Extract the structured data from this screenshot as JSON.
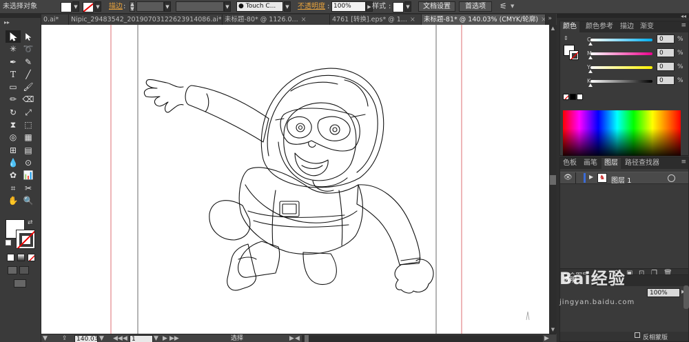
{
  "control_bar": {
    "selection_status": "未选择对象",
    "stroke_label": "描边",
    "brush_name": "Touch C...",
    "opacity_label": "不透明度",
    "opacity_value": "100%",
    "style_label": "样式",
    "doc_setup_button": "文档设置",
    "preferences_button": "首选项"
  },
  "doc_tabs": [
    {
      "label": "0.ai*"
    },
    {
      "label": "Nipic_29483542_20190703122623914086.ai*"
    },
    {
      "label": "未标题-80* @ 1126.0..."
    },
    {
      "label": "4761 [转换].eps* @ 1..."
    },
    {
      "label": "未标题-81* @ 140.03% (CMYK/轮廓)"
    }
  ],
  "color_panel": {
    "tabs": [
      "颜色",
      "颜色参考",
      "描边",
      "渐变"
    ],
    "channels": [
      {
        "name": "C",
        "value": "0",
        "unit": "%"
      },
      {
        "name": "M",
        "value": "0",
        "unit": "%"
      },
      {
        "name": "Y",
        "value": "0",
        "unit": "%"
      },
      {
        "name": "K",
        "value": "0",
        "unit": "%"
      }
    ]
  },
  "layers_panel": {
    "tabs": [
      "色板",
      "画笔",
      "图层",
      "路径查找器"
    ],
    "layers": [
      {
        "name": "图层 1"
      }
    ],
    "footer_count": "1 个图层"
  },
  "transparency_panel": {
    "tab": "透明",
    "opacity_value": "100%",
    "footer": "反相蒙版"
  },
  "status_bar": {
    "zoom": "140.03",
    "artboard": "1",
    "tool_status": "选择"
  },
  "watermark": {
    "main": "Bai经验",
    "sub": "jingyan.baidu.com"
  },
  "colors": {
    "app_bg": "#3b3b3b",
    "panel_bg": "#3a3a3a",
    "accent_orange": "#e8a33d",
    "guide_red": "#d4474c",
    "artboard_bg": "#ffffff"
  }
}
